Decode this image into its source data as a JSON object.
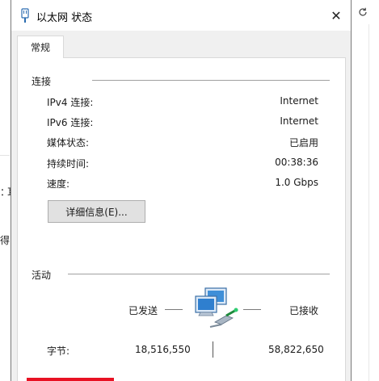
{
  "background": {
    "left_fragment_1": "：",
    "left_fragment_1b": "耳",
    "left_fragment_2": "得",
    "refresh_icon": "refresh-icon"
  },
  "dialog": {
    "title": "以太网 状态",
    "close_label": "✕",
    "tab_label": "常规",
    "connection": {
      "heading": "连接",
      "rows": [
        {
          "label": "IPv4 连接:",
          "value": "Internet"
        },
        {
          "label": "IPv6 连接:",
          "value": "Internet"
        },
        {
          "label": "媒体状态:",
          "value": "已启用"
        },
        {
          "label": "持续时间:",
          "value": "00:38:36"
        },
        {
          "label": "速度:",
          "value": "1.0 Gbps"
        }
      ],
      "details_button": "详细信息(E)..."
    },
    "activity": {
      "heading": "活动",
      "sent_label": "已发送",
      "received_label": "已接收",
      "bytes_label": "字节:",
      "bytes_sent": "18,516,550",
      "bytes_received": "58,822,650"
    }
  },
  "colors": {
    "accent_red": "#e81123",
    "dialog_bg": "#f0f0f0",
    "panel_bg": "#ffffff"
  }
}
